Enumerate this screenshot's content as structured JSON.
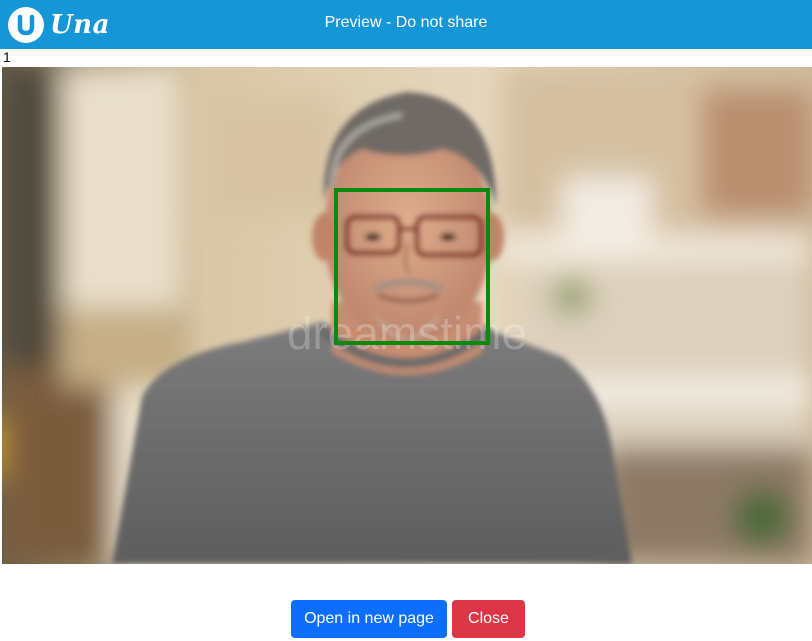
{
  "header": {
    "logo_letter": "u",
    "logo_text": "Una",
    "title": "Preview - Do not share",
    "background_color": "#1596d6"
  },
  "page_index": "1",
  "preview": {
    "watermark": "dreamstime",
    "face_box_color": "#0b8a10"
  },
  "actions": {
    "open_label": "Open in new page",
    "close_label": "Close",
    "open_color": "#0d6efd",
    "close_color": "#dc3545"
  }
}
